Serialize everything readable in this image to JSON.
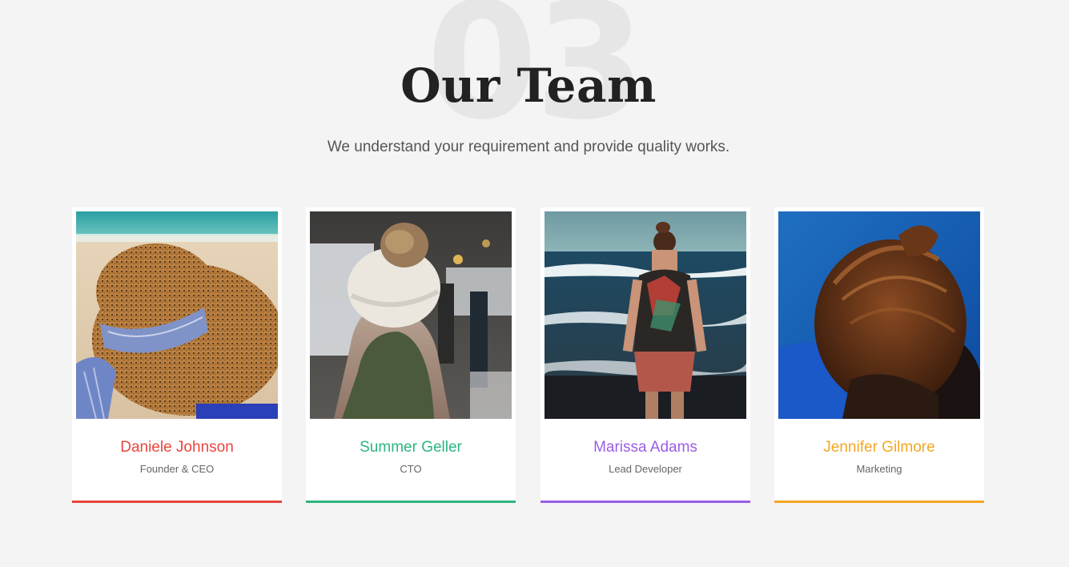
{
  "section": {
    "number": "03",
    "title": "Our Team",
    "subtitle": "We understand your requirement and provide quality works."
  },
  "team": [
    {
      "name": "Daniele Johnson",
      "role": "Founder & CEO",
      "color": "#e8453c",
      "photo": "woman-straw-hat-beach-photo"
    },
    {
      "name": "Summer Geller",
      "role": "CTO",
      "color": "#2db57f",
      "photo": "woman-knit-beanie-street-photo"
    },
    {
      "name": "Marissa Adams",
      "role": "Lead Developer",
      "color": "#9b5de5",
      "photo": "woman-walking-seashore-photo"
    },
    {
      "name": "Jennifer Gilmore",
      "role": "Marketing",
      "color": "#f5a623",
      "photo": "woman-ponytail-blue-sky-photo"
    }
  ]
}
